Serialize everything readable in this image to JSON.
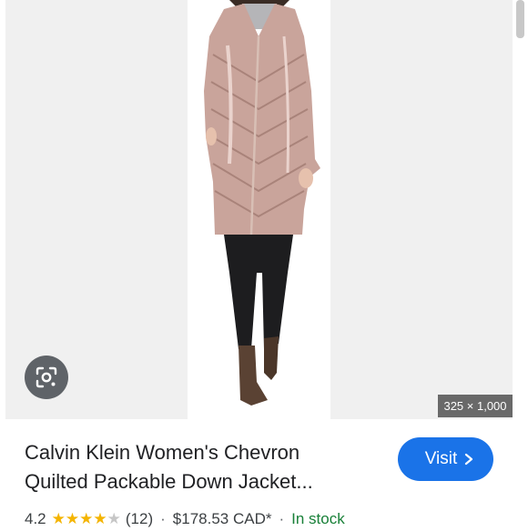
{
  "image": {
    "dimensions": "325 × 1,000",
    "colors": {
      "panel": "#f0f0f0",
      "coat": "#c9a49b",
      "pants": "#1d1d1f",
      "boots": "#5a4233",
      "sweater": "#b5b5b8"
    }
  },
  "lens": {
    "icon": "google-lens-icon"
  },
  "product": {
    "title_line1": "Calvin Klein Women's Chevron",
    "title_line2": "Quilted Packable Down Jacket..."
  },
  "visit": {
    "label": "Visit",
    "icon": "chevron-right-icon",
    "color": "#1a73e8"
  },
  "meta": {
    "rating": "4.2",
    "stars_filled": 4,
    "stars_empty": 1,
    "review_count": "(12)",
    "separator": "·",
    "price": "$178.53 CAD*",
    "availability": "In stock",
    "availability_color": "#188038"
  }
}
